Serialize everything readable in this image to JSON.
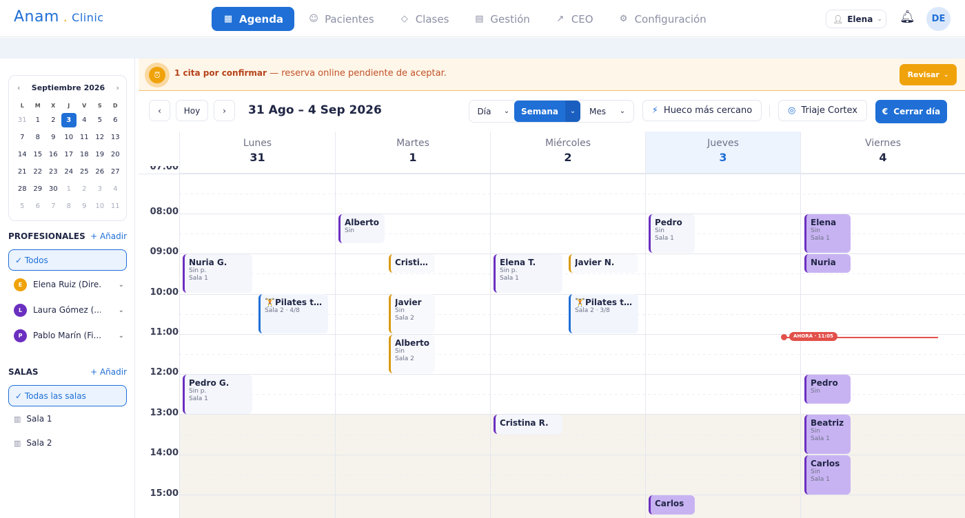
{
  "header": {
    "brand": "Anam",
    "brand_sub": "Clinic",
    "nav": [
      {
        "label": "Agenda",
        "icon": "calendar-icon"
      },
      {
        "label": "Pacientes",
        "icon": "users-icon"
      },
      {
        "label": "Clases",
        "icon": "graduation-icon"
      },
      {
        "label": "Gestión",
        "icon": "receipt-icon"
      },
      {
        "label": "CEO",
        "icon": "chart-icon"
      },
      {
        "label": "Configuración",
        "icon": "gear-icon"
      }
    ],
    "user_name": "Elena",
    "avatar_initials": "DE"
  },
  "minical": {
    "month_label": "Septiembre 2026",
    "dow": [
      "L",
      "M",
      "X",
      "J",
      "V",
      "S",
      "D"
    ],
    "weeks": [
      [
        "31",
        "1",
        "2",
        "3",
        "4",
        "5",
        "6"
      ],
      [
        "7",
        "8",
        "9",
        "10",
        "11",
        "12",
        "13"
      ],
      [
        "14",
        "15",
        "16",
        "17",
        "18",
        "19",
        "20"
      ],
      [
        "21",
        "22",
        "23",
        "24",
        "25",
        "26",
        "27"
      ],
      [
        "28",
        "29",
        "30",
        "1",
        "2",
        "3",
        "4"
      ],
      [
        "5",
        "6",
        "7",
        "8",
        "9",
        "10",
        "11"
      ]
    ]
  },
  "profesionales": {
    "title": "PROFESIONALES",
    "add_label": "+ Añadir",
    "all_label": "✓ Todos",
    "items": [
      {
        "initial": "E",
        "name": "Elena Ruiz (Dire...",
        "color": "#f0a20a"
      },
      {
        "initial": "L",
        "name": "Laura Gómez (...",
        "color": "#6b2fc0"
      },
      {
        "initial": "P",
        "name": "Pablo Marín (Fi...",
        "color": "#6b2fc0"
      }
    ]
  },
  "salas": {
    "title": "SALAS",
    "add_label": "+ Añadir",
    "all_label": "✓ Todas las salas",
    "items": [
      {
        "name": "Sala 1"
      },
      {
        "name": "Sala 2"
      }
    ]
  },
  "alert": {
    "bold": "1 cita por confirmar",
    "text": " — reserva online pendiente de aceptar.",
    "button": "Revisar"
  },
  "toolbar": {
    "today_label": "Hoy",
    "range_title": "31 Ago – 4 Sep 2026",
    "views": [
      "Día",
      "Semana",
      "Mes"
    ],
    "active_view": "Semana",
    "hueco_label": "Hueco más cercano",
    "triaje_label": "Triaje Cortex",
    "cerrar_label": "Cerrar día"
  },
  "calendar": {
    "days": [
      {
        "name": "Lunes",
        "num": "31"
      },
      {
        "name": "Martes",
        "num": "1"
      },
      {
        "name": "Miércoles",
        "num": "2"
      },
      {
        "name": "Jueves",
        "num": "3",
        "today": true
      },
      {
        "name": "Viernes",
        "num": "4"
      }
    ],
    "hours": [
      "07:00",
      "08:00",
      "09:00",
      "10:00",
      "11:00",
      "12:00",
      "13:00",
      "14:00",
      "15:00"
    ],
    "now_label": "AHORA · 11:05",
    "events": [
      {
        "title": "Alberto",
        "lines": [
          "Sin"
        ]
      },
      {
        "title": "Pedro",
        "lines": [
          "Sin",
          "Sala 1"
        ]
      },
      {
        "title": "Elena",
        "lines": [
          "Sin",
          "Sala 1"
        ]
      },
      {
        "title": "Nuria G.",
        "lines": [
          "Sin p.",
          "Sala 1"
        ]
      },
      {
        "title": "Cristin…",
        "lines": []
      },
      {
        "title": "Elena T.",
        "lines": [
          "Sin p.",
          "Sala 1"
        ]
      },
      {
        "title": "Javier N.",
        "lines": []
      },
      {
        "title": "Nuria",
        "lines": []
      },
      {
        "title": "🏋Pilates ter…",
        "lines": [
          "Sala 2 · 4/8"
        ]
      },
      {
        "title": "Javier",
        "lines": [
          "Sin",
          "Sala 2"
        ]
      },
      {
        "title": "🏋Pilates ter…",
        "lines": [
          "Sala 2 · 3/8"
        ]
      },
      {
        "title": "Alberto",
        "lines": [
          "Sin",
          "Sala 2"
        ]
      },
      {
        "title": "Pedro G.",
        "lines": [
          "Sin p.",
          "Sala 1"
        ]
      },
      {
        "title": "Pedro",
        "lines": [
          "Sin"
        ]
      },
      {
        "title": "Cristina R.",
        "lines": []
      },
      {
        "title": "Beatriz",
        "lines": [
          "Sin",
          "Sala 1"
        ]
      },
      {
        "title": "Carlos",
        "lines": [
          "Sin",
          "Sala 1"
        ]
      },
      {
        "title": "Carlos",
        "lines": []
      }
    ]
  }
}
